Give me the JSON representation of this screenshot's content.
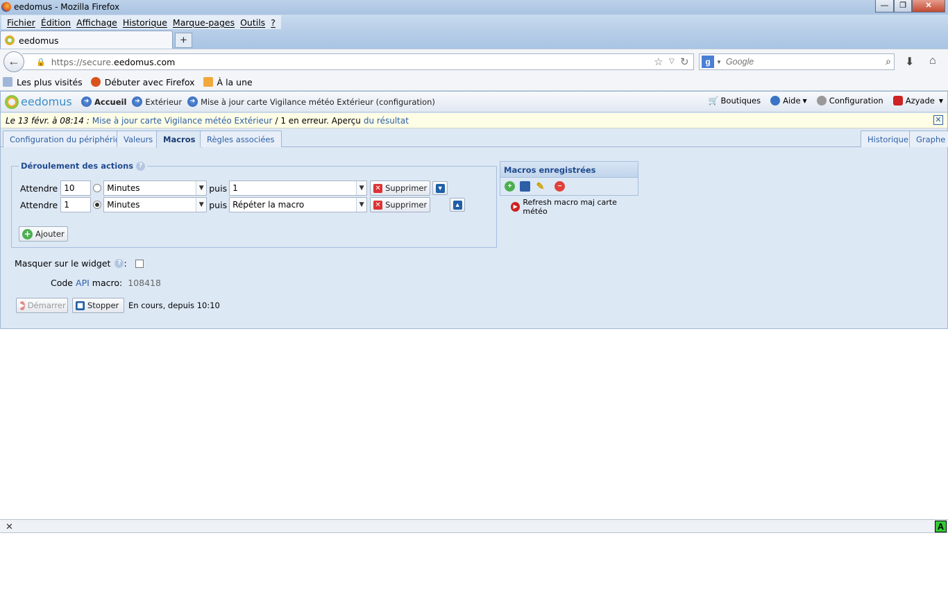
{
  "window": {
    "title": "eedomus - Mozilla Firefox",
    "minimize": "—",
    "maximize": "❐",
    "close": "✕"
  },
  "menu": [
    "Fichier",
    "Édition",
    "Affichage",
    "Historique",
    "Marque-pages",
    "Outils",
    "?"
  ],
  "browser_tab": {
    "title": "eedomus",
    "new_tab": "+"
  },
  "url": {
    "prefix": "https://secure.",
    "domain": "eedomus.com"
  },
  "search": {
    "placeholder": "Google"
  },
  "bookmarks": [
    "Les plus visités",
    "Débuter avec Firefox",
    "À la une"
  ],
  "app": {
    "logo": "eedomus",
    "breadcrumb": [
      "Accueil",
      "Extérieur",
      "Mise à jour carte Vigilance météo Extérieur (configuration)"
    ],
    "right_nav": [
      "Boutiques",
      "Aide",
      "Configuration",
      "Azyade"
    ]
  },
  "notice": {
    "date": "Le 13 févr. à 08:14 :",
    "link": "Mise à jour carte Vigilance météo Extérieur",
    "middle": "/ 1 en erreur. Aperçu",
    "result": "du résultat"
  },
  "tabs": [
    "Configuration du périphérique",
    "Valeurs",
    "Macros",
    "Règles associées"
  ],
  "tabs_right": [
    "Historique",
    "Graphe"
  ],
  "actions": {
    "legend": "Déroulement des actions",
    "rows": [
      {
        "wait_label": "Attendre",
        "value": "10",
        "unit": "Minutes",
        "then": "puis",
        "action": "1",
        "delete": "Supprimer",
        "move": "down"
      },
      {
        "wait_label": "Attendre",
        "value": "1",
        "unit": "Minutes",
        "then": "puis",
        "action": "Répéter la macro",
        "delete": "Supprimer",
        "move": "up"
      }
    ],
    "add": "Ajouter"
  },
  "saved_macros": {
    "title": "Macros enregistrées",
    "items": [
      "Refresh macro maj carte météo"
    ]
  },
  "hide_widget": {
    "label": "Masquer sur le widget",
    "colon": ":"
  },
  "api": {
    "label_pre": "Code",
    "label_api": "API",
    "label_post": "macro:",
    "value": "108418"
  },
  "controls": {
    "start": "Démarrer",
    "stop": "Stopper",
    "status": "En cours, depuis 10:10"
  },
  "statusbar": {
    "close": "✕",
    "indicator": "A"
  }
}
